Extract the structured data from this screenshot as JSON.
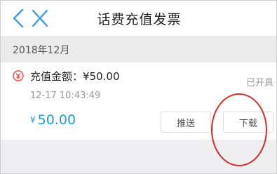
{
  "header": {
    "title": "话费充值发票",
    "back_icon": "chevron-left-icon",
    "close_icon": "close-icon",
    "accent_color": "#3d9be0"
  },
  "month": {
    "label": "2018年12月"
  },
  "invoice": {
    "icon": "yen-circle-icon",
    "icon_color": "#e2483d",
    "title": "充值金额：¥50.00",
    "status": "已开具",
    "timestamp": "12-17 10:43:49",
    "price_symbol": "¥",
    "price_value": "50.00",
    "price_color": "#1f9bd7",
    "push_label": "推送",
    "download_label": "下载"
  },
  "annotation": {
    "circle_color": "#d62a2a"
  }
}
